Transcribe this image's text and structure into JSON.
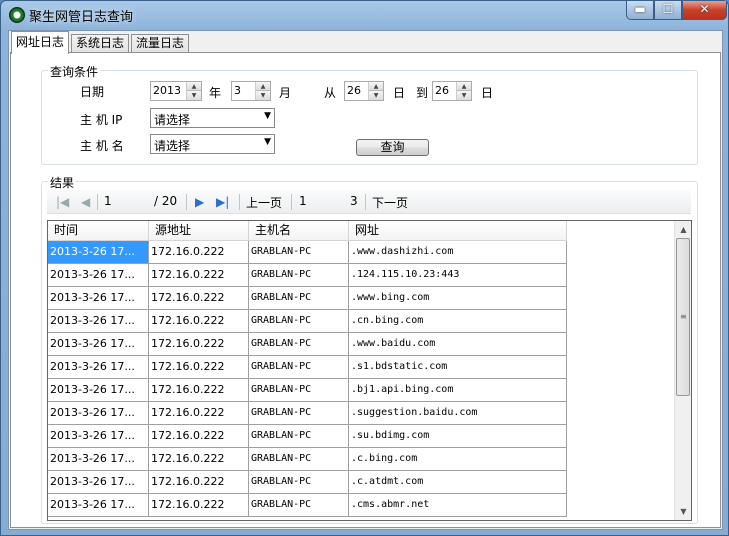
{
  "window": {
    "title": "聚生网管日志查询",
    "minimize_label": "▬",
    "maximize_label": "☐",
    "close_label": "✕"
  },
  "tabs": [
    {
      "label": "网址日志",
      "active": true
    },
    {
      "label": "系统日志",
      "active": false
    },
    {
      "label": "流量日志",
      "active": false
    }
  ],
  "query": {
    "legend": "查询条件",
    "date_label": "日期",
    "year_value": "2013",
    "year_unit": "年",
    "month_value": "3",
    "month_unit": "月",
    "from_label": "从",
    "day_from_value": "26",
    "day_unit": "日",
    "to_label": "到",
    "day_to_value": "26",
    "day_unit_2": "日",
    "host_ip_label": "主 机 IP",
    "host_ip_value": "请选择",
    "host_name_label": "主 机 名",
    "host_name_value": "请选择",
    "search_button": "查询"
  },
  "results": {
    "legend": "结果",
    "pager": {
      "current_page": "1",
      "total_pages": "/ 20",
      "prev_label": "上一页",
      "page_input": "1",
      "page_count": "3",
      "next_label": "下一页"
    },
    "columns": [
      "时间",
      "源地址",
      "主机名",
      "网址"
    ],
    "rows": [
      [
        "2013-3-26 17...",
        "172.16.0.222",
        "GRABLAN-PC",
        ".www.dashizhi.com"
      ],
      [
        "2013-3-26 17...",
        "172.16.0.222",
        "GRABLAN-PC",
        ".124.115.10.23:443"
      ],
      [
        "2013-3-26 17...",
        "172.16.0.222",
        "GRABLAN-PC",
        ".www.bing.com"
      ],
      [
        "2013-3-26 17...",
        "172.16.0.222",
        "GRABLAN-PC",
        ".cn.bing.com"
      ],
      [
        "2013-3-26 17...",
        "172.16.0.222",
        "GRABLAN-PC",
        ".www.baidu.com"
      ],
      [
        "2013-3-26 17...",
        "172.16.0.222",
        "GRABLAN-PC",
        ".s1.bdstatic.com"
      ],
      [
        "2013-3-26 17...",
        "172.16.0.222",
        "GRABLAN-PC",
        ".bj1.api.bing.com"
      ],
      [
        "2013-3-26 17...",
        "172.16.0.222",
        "GRABLAN-PC",
        ".suggestion.baidu.com"
      ],
      [
        "2013-3-26 17...",
        "172.16.0.222",
        "GRABLAN-PC",
        ".su.bdimg.com"
      ],
      [
        "2013-3-26 17...",
        "172.16.0.222",
        "GRABLAN-PC",
        ".c.bing.com"
      ],
      [
        "2013-3-26 17...",
        "172.16.0.222",
        "GRABLAN-PC",
        ".c.atdmt.com"
      ],
      [
        "2013-3-26 17...",
        "172.16.0.222",
        "GRABLAN-PC",
        ".cms.abmr.net"
      ]
    ]
  },
  "colors": {
    "selection": "#3399ff",
    "close_button": "#c8412b",
    "frame": "#8db3da"
  }
}
